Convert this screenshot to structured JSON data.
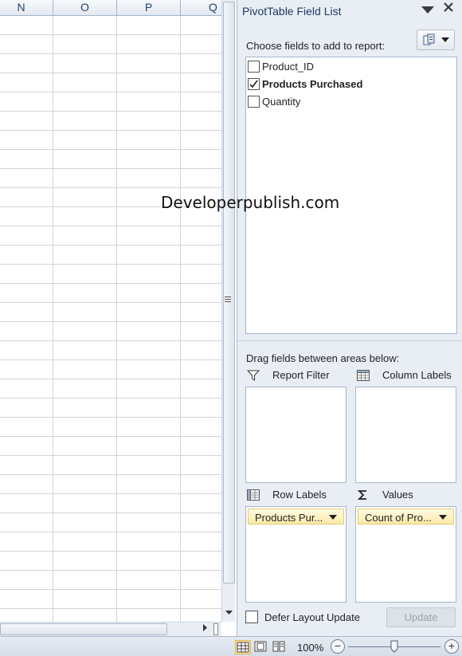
{
  "sheet": {
    "columns": [
      "N",
      "O",
      "P",
      "Q"
    ]
  },
  "pane": {
    "title": "PivotTable Field List",
    "choose_label": "Choose fields to add to report:",
    "fields": [
      {
        "label": "Product_ID",
        "checked": false
      },
      {
        "label": "Products Purchased",
        "checked": true
      },
      {
        "label": "Quantity",
        "checked": false
      }
    ],
    "watermark": "Developerpublish.com",
    "drag_label": "Drag fields between areas below:",
    "areas": {
      "report_filter": {
        "label": "Report Filter",
        "chips": []
      },
      "column_labels": {
        "label": "Column Labels",
        "chips": []
      },
      "row_labels": {
        "label": "Row Labels",
        "chips": [
          "Products Pur..."
        ]
      },
      "values": {
        "label": "Values",
        "chips": [
          "Count of Pro..."
        ]
      }
    },
    "defer_label": "Defer Layout Update",
    "update_label": "Update"
  },
  "status": {
    "zoom": "100%",
    "zoom_minus": "−",
    "zoom_plus": "+"
  },
  "colors": {
    "accent": "#1d3a63",
    "chip_bg": "#fbeaa8",
    "pane_bg": "#e9eef5"
  }
}
